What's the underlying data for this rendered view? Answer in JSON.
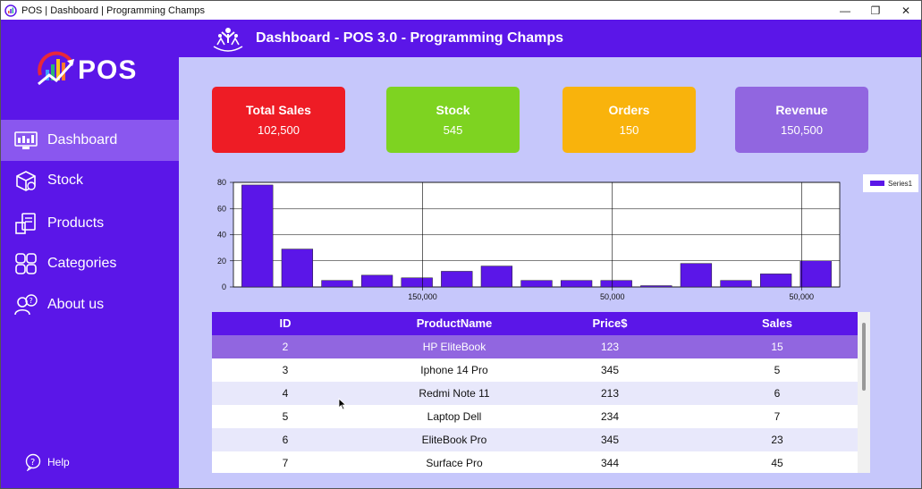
{
  "window": {
    "title": "POS | Dashboard | Programming Champs",
    "controls": [
      "—",
      "❐",
      "✕"
    ]
  },
  "sidebar": {
    "logo_text": "POS",
    "items": [
      {
        "label": "Dashboard",
        "icon": "dashboard-icon",
        "active": true
      },
      {
        "label": "Stock",
        "icon": "box-icon",
        "active": false
      },
      {
        "label": "Products",
        "icon": "products-icon",
        "active": false
      },
      {
        "label": "Categories",
        "icon": "categories-icon",
        "active": false
      },
      {
        "label": "About us",
        "icon": "about-icon",
        "active": false
      }
    ],
    "help_label": "Help"
  },
  "header": {
    "title": "Dashboard - POS 3.0 - Programming Champs"
  },
  "cards": [
    {
      "title": "Total Sales",
      "value": "102,500",
      "color": "#ee1c25"
    },
    {
      "title": "Stock",
      "value": "545",
      "color": "#7ed321"
    },
    {
      "title": "Orders",
      "value": "150",
      "color": "#f9b30c"
    },
    {
      "title": "Revenue",
      "value": "150,500",
      "color": "#9166e0"
    }
  ],
  "chart_data": {
    "type": "bar",
    "series": [
      {
        "name": "Series1",
        "values": [
          78,
          29,
          5,
          9,
          7,
          12,
          16,
          5,
          5,
          5,
          1,
          18,
          5,
          10,
          20
        ]
      }
    ],
    "x_tick_labels": [
      "150,000",
      "50,000",
      "50,000"
    ],
    "y_ticks": [
      0,
      20,
      40,
      60,
      80
    ],
    "ylim": [
      0,
      80
    ],
    "grid": true,
    "legend": "top-right",
    "color": "#5b16e8"
  },
  "table": {
    "headers": [
      "ID",
      "ProductName",
      "Price$",
      "Sales"
    ],
    "rows": [
      {
        "id": "2",
        "name": "HP EliteBook",
        "price": "123",
        "sales": "15"
      },
      {
        "id": "3",
        "name": "Iphone 14 Pro",
        "price": "345",
        "sales": "5"
      },
      {
        "id": "4",
        "name": "Redmi Note 11",
        "price": "213",
        "sales": "6"
      },
      {
        "id": "5",
        "name": "Laptop Dell",
        "price": "234",
        "sales": "7"
      },
      {
        "id": "6",
        "name": "EliteBook Pro",
        "price": "345",
        "sales": "23"
      },
      {
        "id": "7",
        "name": "Surface Pro",
        "price": "344",
        "sales": "45"
      }
    ]
  }
}
